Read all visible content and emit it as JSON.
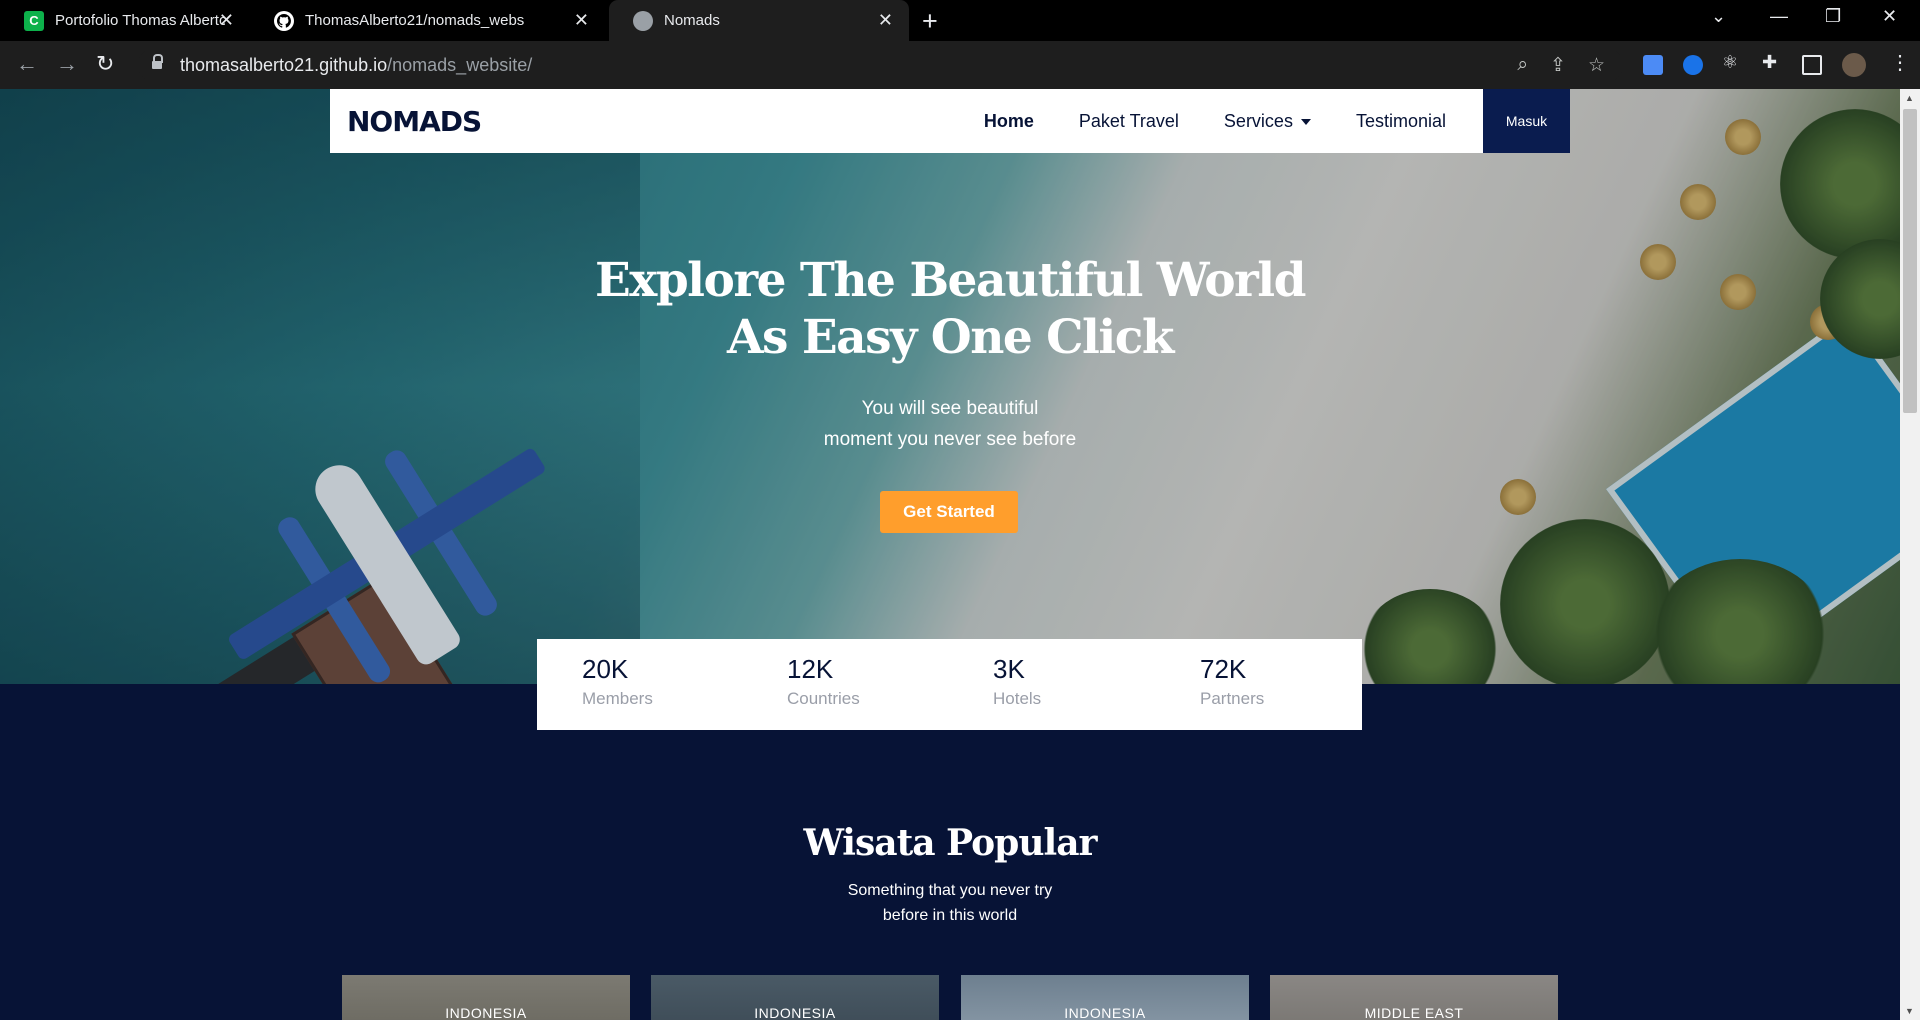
{
  "browser": {
    "tabs": [
      {
        "title": "Portofolio Thomas Alberto | Cake",
        "active": false
      },
      {
        "title": "ThomasAlberto21/nomads_webs",
        "active": false
      },
      {
        "title": "Nomads",
        "active": true
      }
    ],
    "url_host": "thomasalberto21.github.io",
    "url_path": "/nomads_website/"
  },
  "navbar": {
    "logo": "NOMADS",
    "items": [
      "Home",
      "Paket Travel",
      "Services",
      "Testimonial"
    ],
    "login": "Masuk"
  },
  "hero": {
    "title_line1": "Explore The Beautiful World",
    "title_line2": "As Easy One Click",
    "sub_line1": "You will see beautiful",
    "sub_line2": "moment you never see before",
    "cta": "Get Started"
  },
  "stats": [
    {
      "value": "20K",
      "label": "Members"
    },
    {
      "value": "12K",
      "label": "Countries"
    },
    {
      "value": "3K",
      "label": "Hotels"
    },
    {
      "value": "72K",
      "label": "Partners"
    }
  ],
  "popular": {
    "title": "Wisata Popular",
    "sub_line1": "Something that you never try",
    "sub_line2": "before in this world",
    "cards": [
      "INDONESIA",
      "INDONESIA",
      "INDONESIA",
      "MIDDLE EAST"
    ]
  },
  "colors": {
    "navy": "#071336",
    "accent": "#ff9e2c",
    "login_bg": "#0a1c4f"
  },
  "icons": [
    "back-icon",
    "forward-icon",
    "reload-icon",
    "lock-icon",
    "zoom-icon",
    "share-icon",
    "star-icon",
    "extensions-icon",
    "sidepanel-icon",
    "menu-icon"
  ]
}
